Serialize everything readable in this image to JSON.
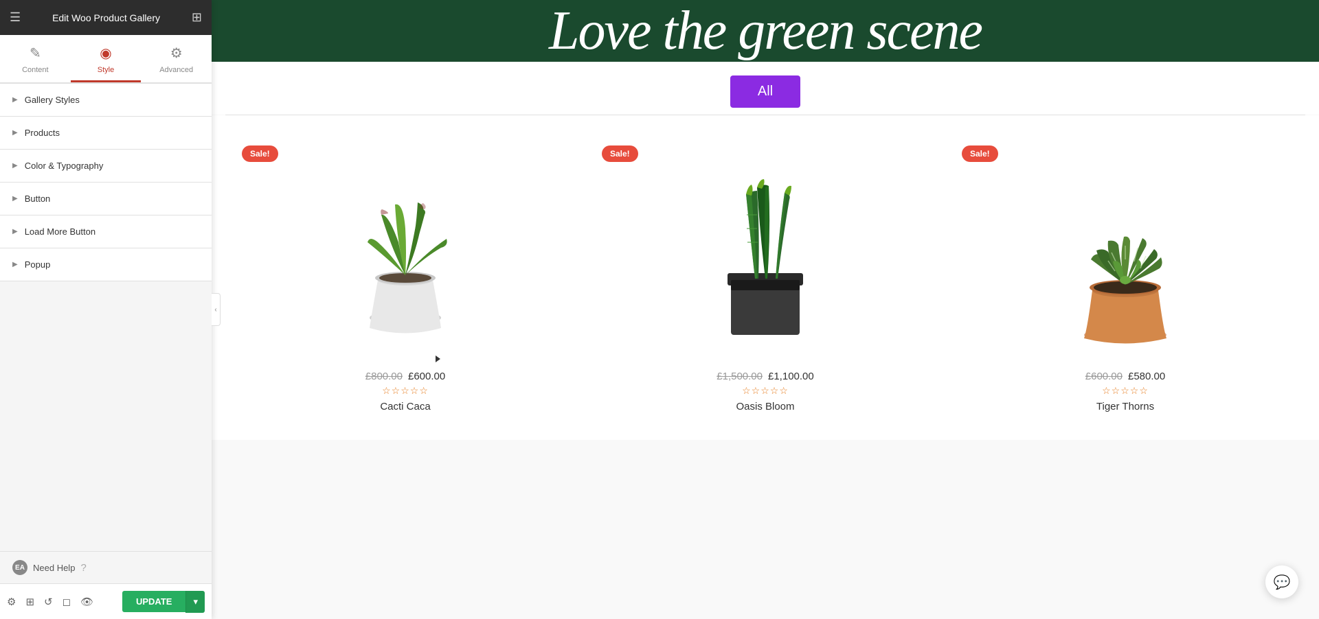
{
  "header": {
    "title": "Edit Woo Product Gallery",
    "hamburger_label": "☰",
    "grid_label": "⊞"
  },
  "tabs": [
    {
      "id": "content",
      "label": "Content",
      "icon": "✎",
      "active": false
    },
    {
      "id": "style",
      "label": "Style",
      "icon": "◉",
      "active": true
    },
    {
      "id": "advanced",
      "label": "Advanced",
      "icon": "⚙",
      "active": false
    }
  ],
  "accordion": [
    {
      "id": "gallery-styles",
      "label": "Gallery Styles"
    },
    {
      "id": "products",
      "label": "Products"
    },
    {
      "id": "color-typography",
      "label": "Color & Typography"
    },
    {
      "id": "button",
      "label": "Button"
    },
    {
      "id": "load-more-button",
      "label": "Load More Button"
    },
    {
      "id": "popup",
      "label": "Popup"
    }
  ],
  "footer": {
    "need_help": "Need Help",
    "ea_badge": "EA"
  },
  "toolbar": {
    "update_label": "UPDATE",
    "dropdown_arrow": "▾"
  },
  "banner": {
    "text": "Love the green scene"
  },
  "filter": {
    "all_label": "All"
  },
  "products": [
    {
      "name": "Cacti Caca",
      "price_old": "£800.00",
      "price_new": "£600.00",
      "stars": "★★★★★",
      "stars_filled": 0,
      "sale": true,
      "sale_label": "Sale!",
      "type": "aloe"
    },
    {
      "name": "Oasis Bloom",
      "price_old": "£1,500.00",
      "price_new": "£1,100.00",
      "stars": "★★★★★",
      "stars_filled": 0,
      "sale": true,
      "sale_label": "Sale!",
      "type": "snake"
    },
    {
      "name": "Tiger Thorns",
      "price_old": "£600.00",
      "price_new": "£580.00",
      "stars": "★★★★★",
      "stars_filled": 0,
      "sale": true,
      "sale_label": "Sale!",
      "type": "cactus"
    }
  ],
  "colors": {
    "active_tab": "#c0392b",
    "panel_bg": "#f5f5f5",
    "header_bg": "#2d2d2d",
    "filter_btn": "#8b2be2",
    "sale_badge": "#e74c3c",
    "update_btn": "#27ae60",
    "banner_bg": "#1a4a2e",
    "star_color": "#e67e22"
  }
}
